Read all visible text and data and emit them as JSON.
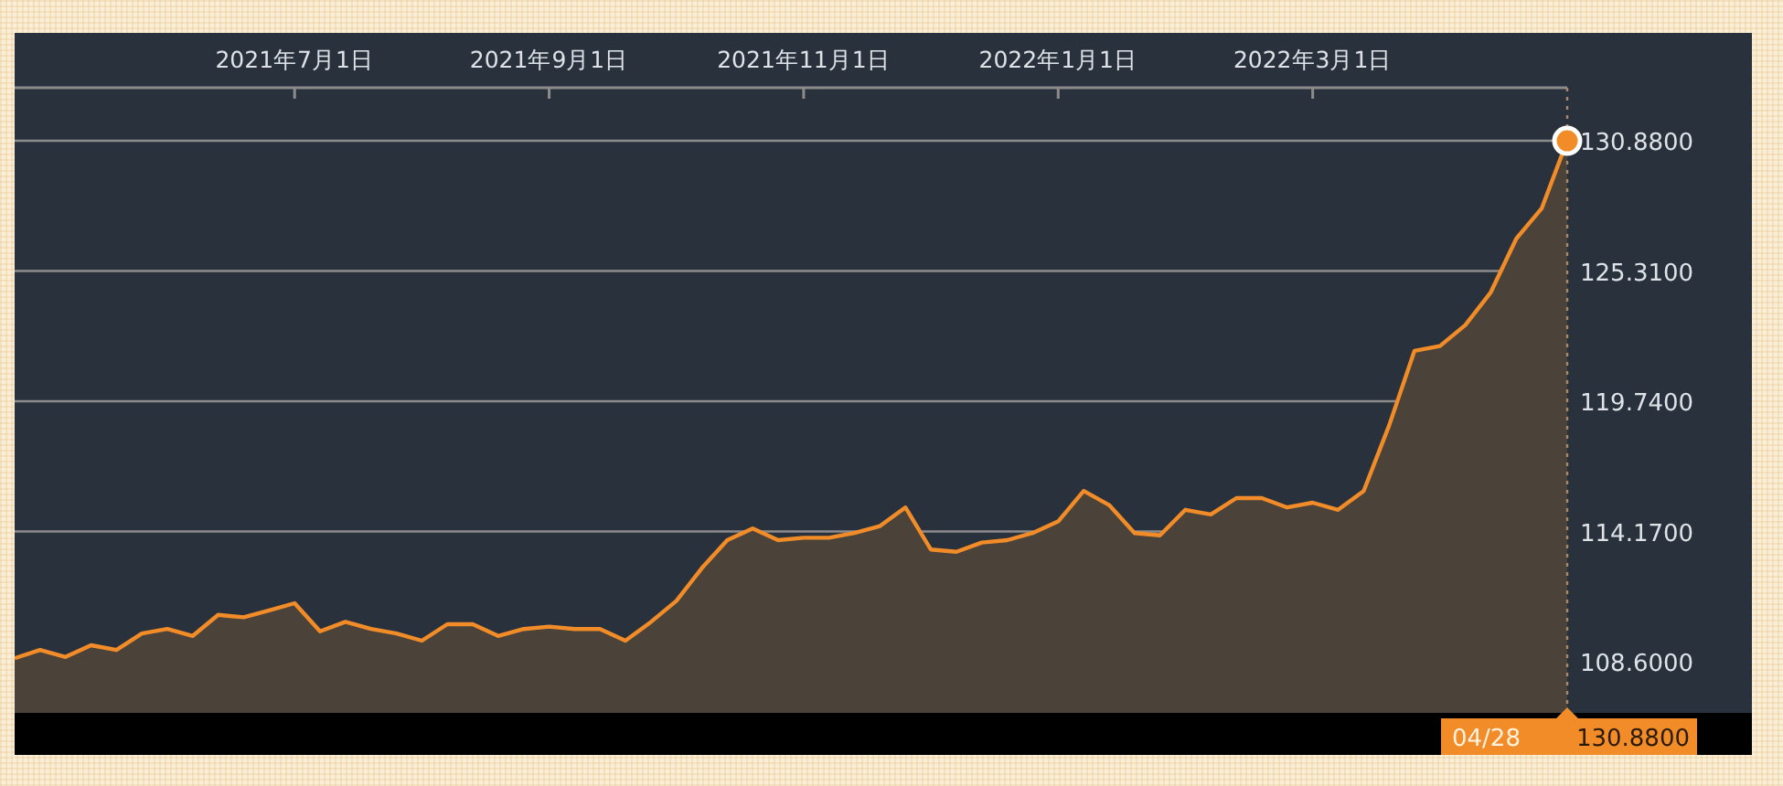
{
  "chart": {
    "chart_data": {
      "type": "area",
      "grid": true,
      "categories": [
        null,
        null,
        null,
        null,
        null,
        null,
        null,
        null,
        null,
        null,
        null,
        "2021年7月1日",
        null,
        null,
        null,
        null,
        null,
        null,
        null,
        null,
        null,
        "2021年9月1日",
        null,
        null,
        null,
        null,
        null,
        null,
        null,
        null,
        null,
        "2021年11月1日",
        null,
        null,
        null,
        null,
        null,
        null,
        null,
        null,
        null,
        "2022年1月1日",
        null,
        null,
        null,
        null,
        null,
        null,
        null,
        null,
        null,
        "2022年3月1日",
        null,
        null,
        null,
        null,
        null,
        null,
        null,
        null,
        null,
        null
      ],
      "series": [
        {
          "color": "#f28c28",
          "values": [
            108.75,
            109.1,
            108.8,
            109.3,
            109.1,
            109.8,
            110.0,
            109.7,
            110.6,
            110.5,
            110.8,
            111.1,
            109.9,
            110.3,
            110.0,
            109.8,
            109.5,
            110.2,
            110.2,
            109.7,
            110.0,
            110.1,
            110.0,
            110.0,
            109.5,
            110.3,
            111.2,
            112.6,
            113.8,
            114.3,
            113.8,
            113.9,
            113.9,
            114.1,
            114.4,
            115.2,
            113.4,
            113.3,
            113.7,
            113.8,
            114.1,
            114.6,
            115.9,
            115.3,
            114.1,
            114.0,
            115.1,
            114.9,
            115.6,
            115.6,
            115.2,
            115.4,
            115.1,
            115.9,
            118.7,
            121.9,
            122.1,
            123.0,
            124.4,
            126.7,
            128.0,
            130.88
          ]
        }
      ],
      "ylim": [
        106.41,
        133.15
      ],
      "yticks": [
        {
          "value": 108.6,
          "label": "108.6000"
        },
        {
          "value": 114.17,
          "label": "114.1700"
        },
        {
          "value": 119.74,
          "label": "119.7400"
        },
        {
          "value": 125.31,
          "label": "125.3100"
        },
        {
          "value": 130.88,
          "label": "130.8800"
        }
      ]
    },
    "tooltip": {
      "date": "04/28",
      "value": "130.8800"
    }
  }
}
